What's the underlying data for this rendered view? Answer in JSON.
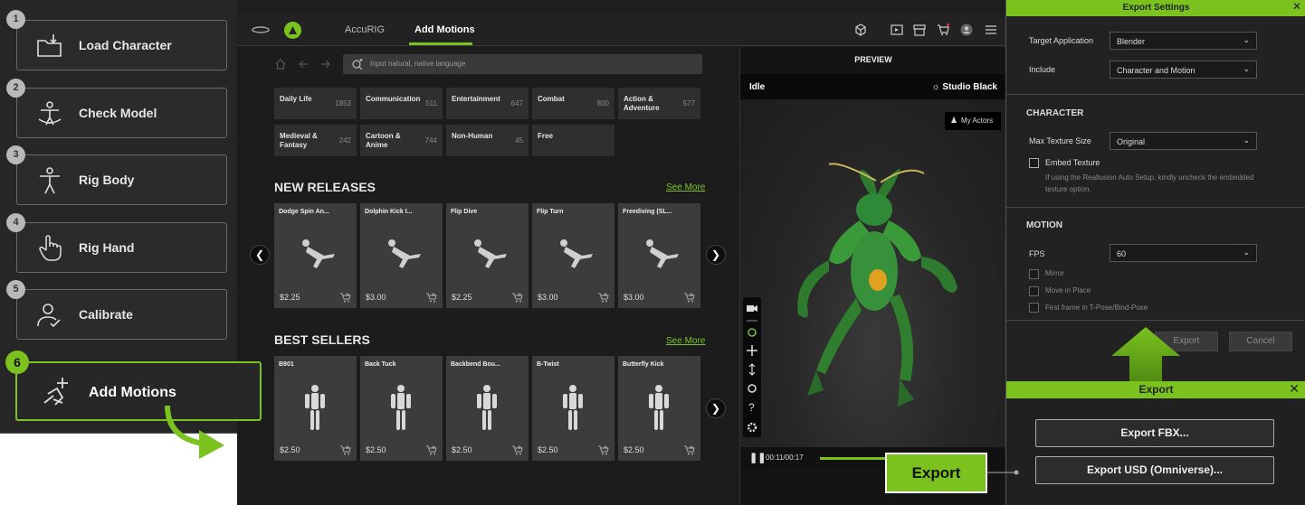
{
  "steps": [
    {
      "num": "1",
      "label": "Load Character"
    },
    {
      "num": "2",
      "label": "Check Model"
    },
    {
      "num": "3",
      "label": "Rig Body"
    },
    {
      "num": "4",
      "label": "Rig Hand"
    },
    {
      "num": "5",
      "label": "Calibrate"
    },
    {
      "num": "6",
      "label": "Add Motions"
    }
  ],
  "topbar": {
    "tab_accurig": "AccuRIG",
    "tab_addmotions": "Add Motions"
  },
  "search": {
    "placeholder": "Input natural, native language"
  },
  "categories": [
    {
      "name": "Daily Life",
      "count": "1853"
    },
    {
      "name": "Communication",
      "count": "511"
    },
    {
      "name": "Entertainment",
      "count": "647"
    },
    {
      "name": "Combat",
      "count": "800"
    },
    {
      "name": "Action & Adventure",
      "count": "577"
    },
    {
      "name": "Medieval & Fantasy",
      "count": "242"
    },
    {
      "name": "Cartoon & Anime",
      "count": "744"
    },
    {
      "name": "Non-Human",
      "count": "45"
    },
    {
      "name": "Free",
      "count": ""
    }
  ],
  "new_releases": {
    "title": "NEW RELEASES",
    "see_more": "See More",
    "items": [
      {
        "title": "Dodge Spin An...",
        "price": "$2.25"
      },
      {
        "title": "Dolphin Kick I...",
        "price": "$3.00"
      },
      {
        "title": "Flip Dive",
        "price": "$2.25"
      },
      {
        "title": "Flip Turn",
        "price": "$3.00"
      },
      {
        "title": "Freediving (SL...",
        "price": "$3.00"
      }
    ]
  },
  "best_sellers": {
    "title": "BEST SELLERS",
    "see_more": "See More",
    "items": [
      {
        "title": "B901",
        "price": "$2.50"
      },
      {
        "title": "Back Tuck",
        "price": "$2.50"
      },
      {
        "title": "Backbend Bou...",
        "price": "$2.50"
      },
      {
        "title": "B-Twist",
        "price": "$2.50"
      },
      {
        "title": "Butterfly Kick",
        "price": "$2.50"
      }
    ]
  },
  "preview": {
    "title": "PREVIEW",
    "mode": "Idle",
    "environment": "Studio Black",
    "my_actors": "My Actors",
    "time": "00:11/00:17"
  },
  "export_settings": {
    "title": "Export Settings",
    "target_label": "Target Application",
    "target_value": "Blender",
    "include_label": "Include",
    "include_value": "Character and Motion",
    "character_header": "CHARACTER",
    "max_texture_label": "Max Texture Size",
    "max_texture_value": "Original",
    "embed_texture": "Embed Texture",
    "embed_hint": "If using the Reallusion Auto Setup, kindly uncheck the embedded texture option.",
    "motion_header": "MOTION",
    "fps_label": "FPS",
    "fps_value": "60",
    "mirror": "Mirror",
    "move_in_place": "Move in Place",
    "first_frame": "First frame in T-Pose/Bind-Pose",
    "export_btn": "Export",
    "cancel_btn": "Cancel"
  },
  "export_dialog": {
    "title": "Export",
    "fbx": "Export FBX...",
    "usd": "Export USD (Omniverse)..."
  },
  "callout": {
    "label": "Export"
  },
  "colors": {
    "accent": "#7bc21f",
    "panel": "#222222",
    "card": "#3c3c3c"
  }
}
